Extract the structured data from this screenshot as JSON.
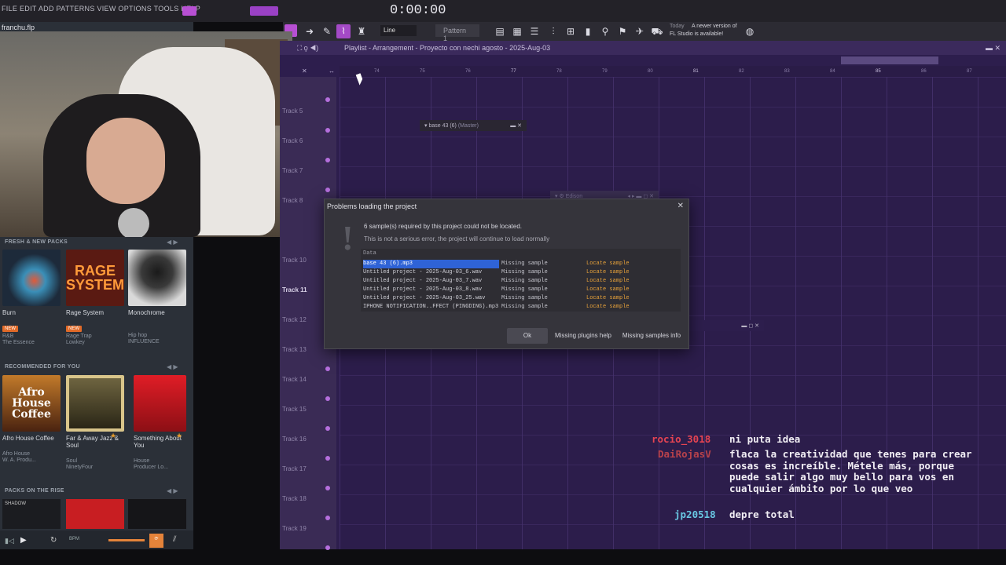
{
  "window": {
    "file_title": "franchu.flp",
    "menu": "FILE EDIT ADD PATTERNS VIEW OPTIONS TOOLS HELP",
    "time": "0:00:00"
  },
  "toolbar": {
    "snap": "Line",
    "pattern": "Pattern 1",
    "news_line1": "A newer version of",
    "news_line2": "FL Studio is available!",
    "news_today": "Today"
  },
  "playlist": {
    "title": "Playlist - Arrangement - Proyecto con nechi agosto - 2025-Aug-03",
    "ruler": [
      "74",
      "75",
      "76",
      "77",
      "78",
      "79",
      "80",
      "81",
      "82",
      "83",
      "84",
      "85",
      "86",
      "87"
    ],
    "tracks": [
      "Track 5",
      "Track 6",
      "Track 7",
      "Track 8",
      "Track 10",
      "Track 11",
      "Track 12",
      "Track 13",
      "Track 14",
      "Track 15",
      "Track 16",
      "Track 17",
      "Track 18",
      "Track 19"
    ],
    "float1": "base 43 (6)",
    "float1_sub": "(Master)",
    "float2": "Edison"
  },
  "dialog": {
    "title": "Problems loading the project",
    "msg1": "6 sample(s) required by this project could not be located.",
    "msg2": "This is not a serious error, the project will continue to load normally",
    "col_header": "Data",
    "rows": [
      {
        "file": "base 43 (6).mp3",
        "status": "Missing sample",
        "action": "Locate sample"
      },
      {
        "file": "Untitled project - 2025-Aug-03_6.wav",
        "status": "Missing sample",
        "action": "Locate sample"
      },
      {
        "file": "Untitled project - 2025-Aug-03_7.wav",
        "status": "Missing sample",
        "action": "Locate sample"
      },
      {
        "file": "Untitled project - 2025-Aug-03_8.wav",
        "status": "Missing sample",
        "action": "Locate sample"
      },
      {
        "file": "Untitled project - 2025-Aug-03_25.wav",
        "status": "Missing sample",
        "action": "Locate sample"
      },
      {
        "file": "IPHONE NOTIFICATION..FFECT (PINGDING).mp3",
        "status": "Missing sample",
        "action": "Locate sample"
      }
    ],
    "btn_ok": "Ok",
    "btn_plugins": "Missing plugins help",
    "btn_samples": "Missing samples info"
  },
  "browser": {
    "sec1": "FRESH & NEW PACKS",
    "sec2": "RECOMMENDED FOR YOU",
    "sec3": "PACKS ON THE RISE",
    "fresh": [
      {
        "name": "Burn",
        "art": "",
        "badge": "NEW",
        "genre": "R&B",
        "author": "The Essence",
        "color": "#1d2a3a"
      },
      {
        "name": "Rage System",
        "art": "RAGE SYSTEM",
        "badge": "NEW",
        "genre": "Rage Trap",
        "author": "Lowkey",
        "color": "#5a1a12"
      },
      {
        "name": "Monochrome",
        "art": "",
        "badge": "",
        "genre": "Hip hop",
        "author": "INFLUENCE",
        "color": "#cfcfcf"
      }
    ],
    "recommended": [
      {
        "name": "Afro House Coffee",
        "art": "Afro House Coffee",
        "genre": "Afro House",
        "author": "W. A. Produ...",
        "color": "#6b3b17"
      },
      {
        "name": "Far & Away Jazz & Soul",
        "art": "",
        "genre": "Soul",
        "author": "NinetyFour",
        "color": "#3a3422"
      },
      {
        "name": "Something About You",
        "art": "",
        "genre": "House",
        "author": "Producer Lo...",
        "color": "#c2161f"
      }
    ],
    "rise": [
      {
        "color": "#1b1c20",
        "label": "SHADOW"
      },
      {
        "color": "#c81e22",
        "label": ""
      },
      {
        "color": "#151518",
        "label": ""
      }
    ],
    "bpm_label": "BPM"
  },
  "chat": [
    {
      "user": "rocio_3018",
      "msg": "ni puta idea",
      "color": "#e64452"
    },
    {
      "user": "DaiRojasV",
      "msg": "flaca la creatividad que tenes para crear cosas es increíble. Métele más, porque puede salir algo muy bello para vos en cualquier ámbito por lo que veo",
      "color": "#b8424b"
    },
    {
      "user": "jp20518",
      "msg": "depre total",
      "color": "#69c7e3"
    }
  ]
}
